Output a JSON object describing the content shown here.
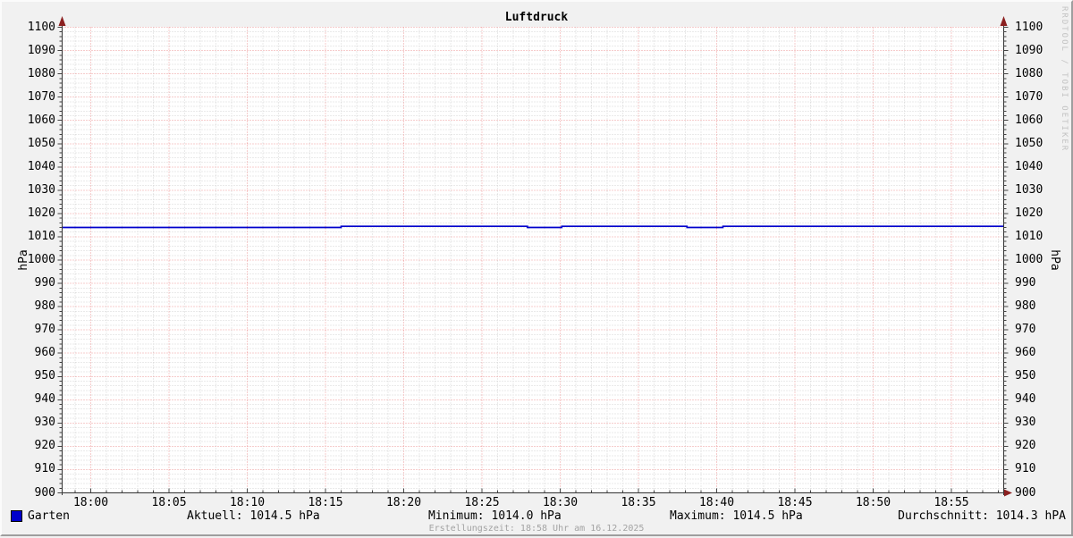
{
  "watermark": "RRDTOOL / TOBI OETIKER",
  "legend": {
    "series_label": "Garten",
    "stats": [
      {
        "label": "Aktuell: 1014.5 hPa"
      },
      {
        "label": "Minimum: 1014.0 hPa"
      },
      {
        "label": "Maximum: 1014.5 hPa"
      },
      {
        "label": "Durchschnitt: 1014.3 hPA"
      }
    ]
  },
  "footer": {
    "creation": "Erstellungszeit: 18:58 Uhr am 16.12.2025"
  },
  "colors": {
    "background": "#f1f1f1",
    "canvas": "#ffffff",
    "grid_minor": "#d4d4d4",
    "grid_major": "#ee9a9a",
    "axis": "#333333",
    "tick": "#444444",
    "arrow": "#8b2020",
    "series_line": "#0000cc",
    "legend_swatch": "#0000cc"
  },
  "chart_data": {
    "type": "line",
    "title": "Luftdruck",
    "ylabel": "hPa",
    "ylabel_right": "hPa",
    "xlabel": "",
    "ylim": [
      900,
      1100
    ],
    "y_major_step": 10,
    "y_minor_step": 2,
    "grid": true,
    "legend_position": "bottom",
    "x_axis": {
      "unit": "minutes after 18:00",
      "range": [
        -1.83,
        58.34
      ],
      "major_step": 5,
      "minor_step": 1,
      "tick_labels": [
        "18:00",
        "18:05",
        "18:10",
        "18:15",
        "18:20",
        "18:25",
        "18:30",
        "18:35",
        "18:40",
        "18:45",
        "18:50",
        "18:55"
      ],
      "tick_times": [
        0,
        5,
        10,
        15,
        20,
        25,
        30,
        35,
        40,
        45,
        50,
        55
      ]
    },
    "series": [
      {
        "name": "Garten",
        "color": "#0000cc",
        "mode": "step",
        "step_points": [
          {
            "t": -1.83,
            "v": 1014.0
          },
          {
            "t": 16.0,
            "v": 1014.5
          },
          {
            "t": 27.9,
            "v": 1014.0
          },
          {
            "t": 30.1,
            "v": 1014.5
          },
          {
            "t": 38.1,
            "v": 1014.0
          },
          {
            "t": 40.4,
            "v": 1014.5
          }
        ],
        "end_t": 58.34
      }
    ],
    "stats": {
      "current": 1014.5,
      "min": 1014.0,
      "max": 1014.5,
      "avg": 1014.3
    }
  }
}
